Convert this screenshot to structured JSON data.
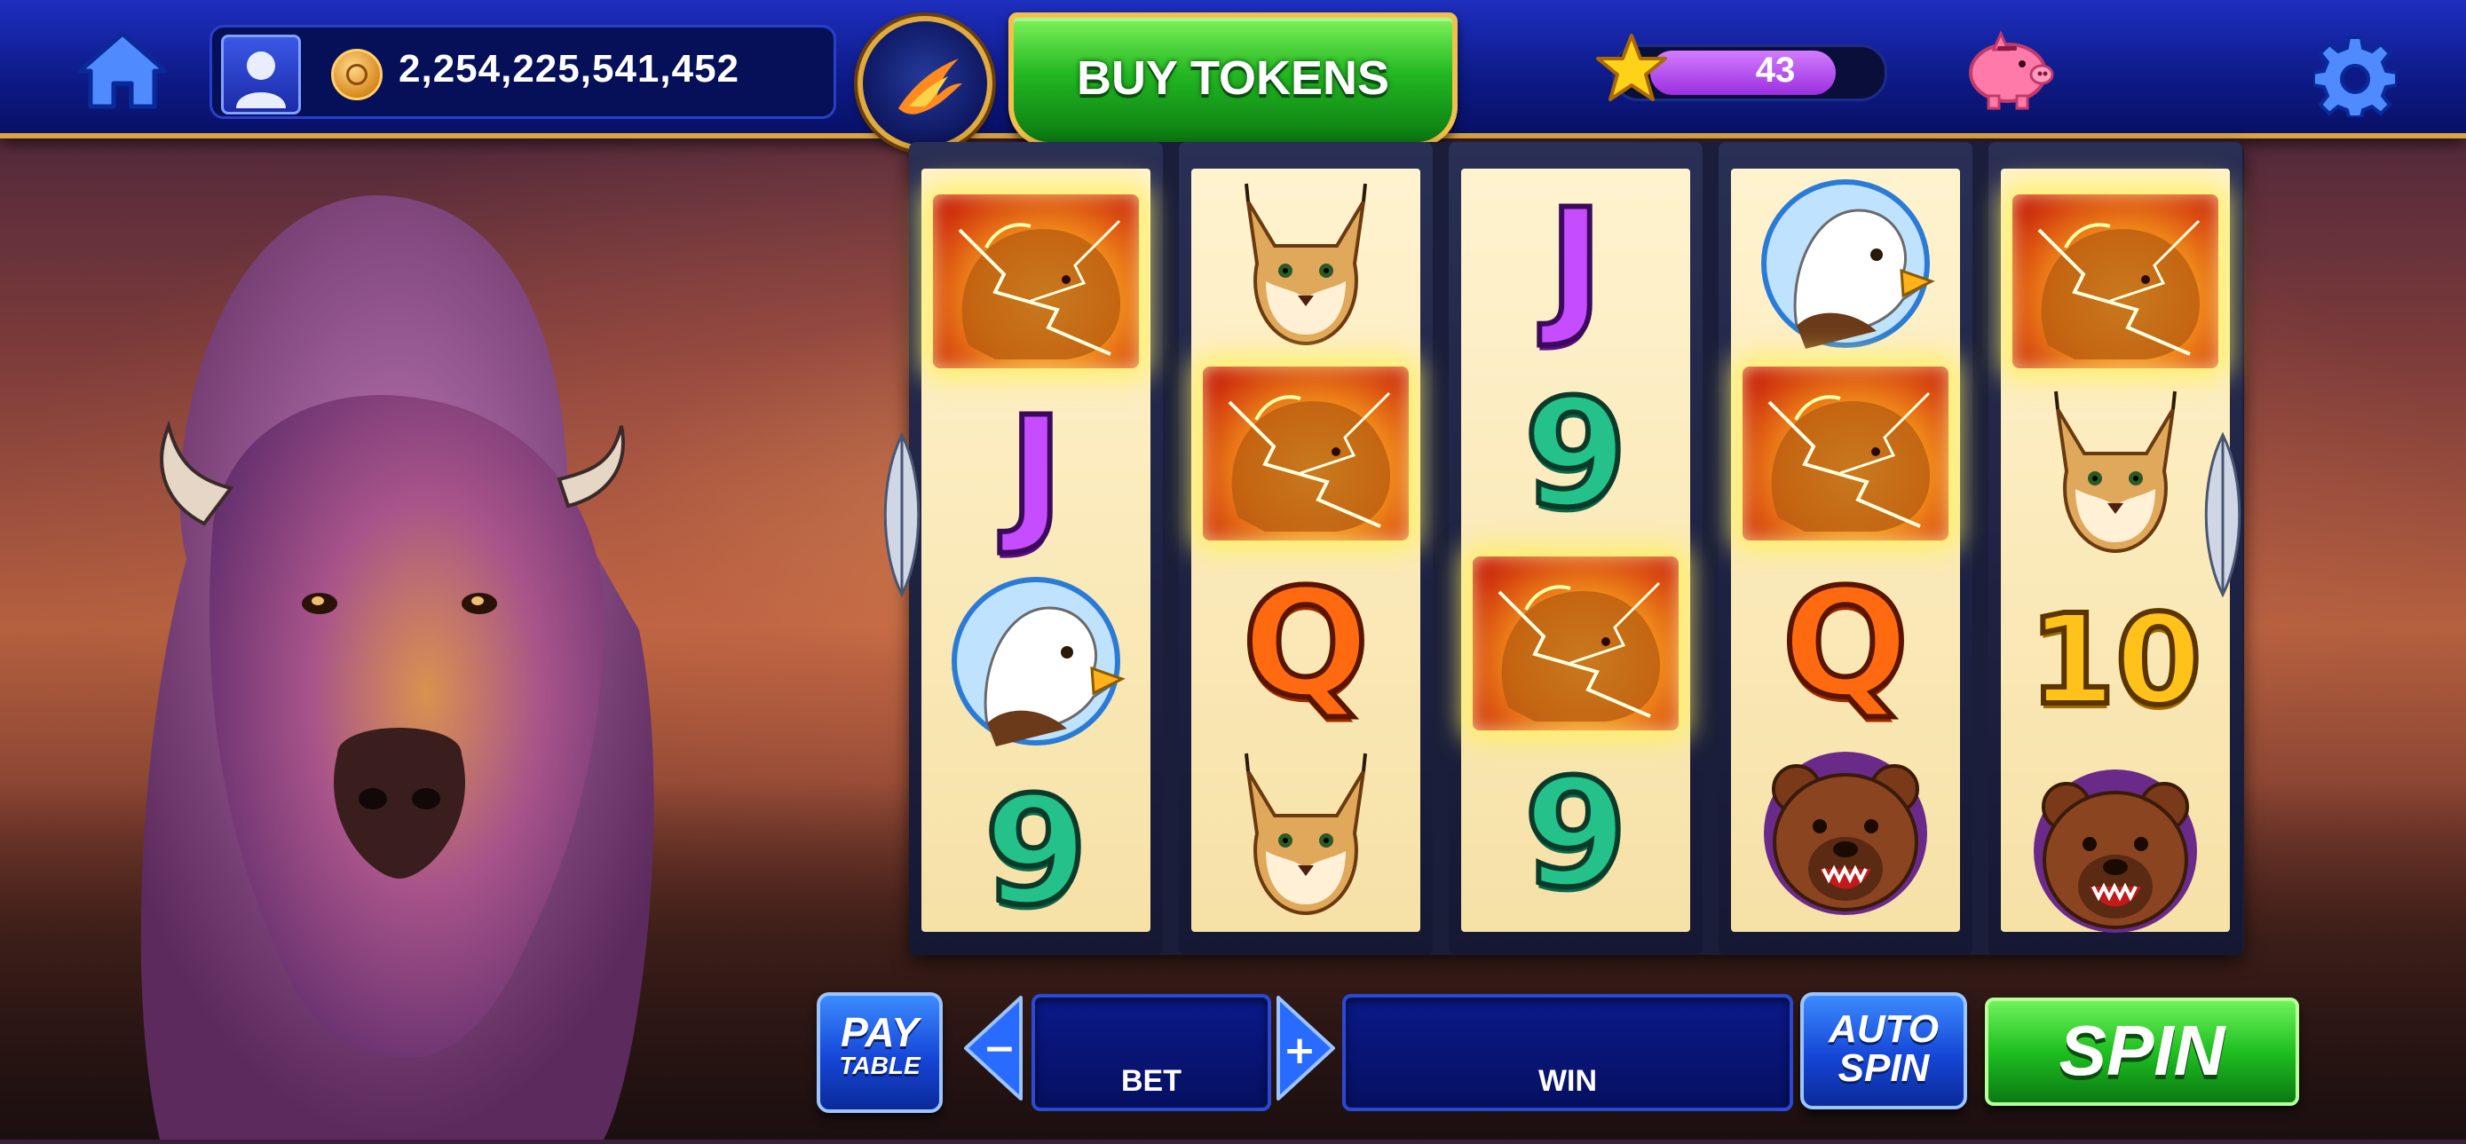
{
  "top_bar": {
    "balance": "2,254,225,541,452",
    "buy_tokens_label": "BUY TOKENS",
    "level": "43",
    "level_progress": 0.82
  },
  "reels": [
    [
      "bison",
      "J",
      "eagle",
      "9"
    ],
    [
      "lynx",
      "bison",
      "Q",
      "lynx"
    ],
    [
      "J",
      "9",
      "bison",
      "9"
    ],
    [
      "eagle",
      "bison",
      "Q",
      "bear"
    ],
    [
      "bison",
      "lynx",
      "10",
      "bear"
    ]
  ],
  "reel_offsets": [
    60,
    0,
    0,
    0,
    60
  ],
  "winning_symbol": "bison",
  "controls": {
    "pay_table_line1": "PAY",
    "pay_table_line2": "TABLE",
    "bet_decrease": "−",
    "bet_increase": "+",
    "bet_label": "BET",
    "win_label": "WIN",
    "auto_spin_line1": "AUTO",
    "auto_spin_line2": "SPIN",
    "spin_label": "SPIN"
  },
  "colors": {
    "topbar": "#0d1a86",
    "buy_tokens": "#23b822",
    "spin": "#1fbf22",
    "gold_trim": "#d9a441"
  }
}
